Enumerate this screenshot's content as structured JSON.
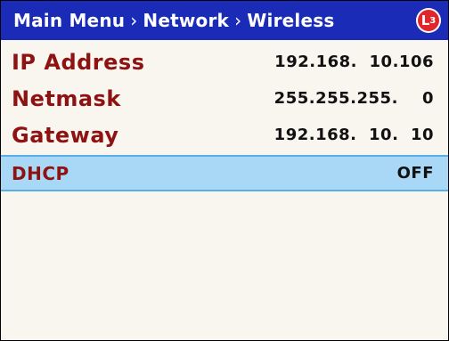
{
  "header": {
    "breadcrumb": [
      "Main Menu",
      "Network",
      "Wireless"
    ],
    "separator": "›",
    "logo_text": "L",
    "logo_sub": "3"
  },
  "rows": [
    {
      "label": "IP Address",
      "value": "192.168.  10.106"
    },
    {
      "label": "Netmask",
      "value": "255.255.255.    0"
    },
    {
      "label": "Gateway",
      "value": "192.168.  10.  10"
    },
    {
      "label": "DHCP",
      "value": "OFF",
      "selected": true
    }
  ],
  "colors": {
    "header_bg": "#1a2bb8",
    "label": "#8e1212",
    "selected_bg": "#a9d8f6",
    "logo": "#e0262b"
  }
}
